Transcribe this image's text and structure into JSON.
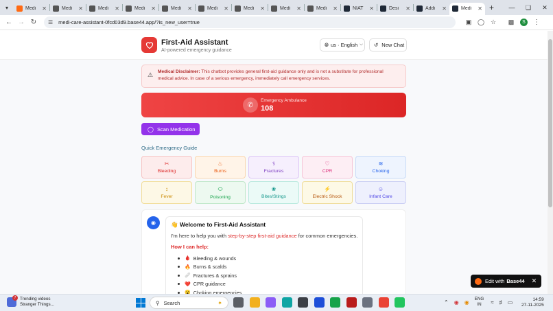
{
  "browser": {
    "tabs": [
      {
        "label": "Medi",
        "favicon_color": "#ff6a13",
        "active": false
      },
      {
        "label": "Medi",
        "favicon_color": "#555555",
        "active": false
      },
      {
        "label": "Medi",
        "favicon_color": "#555555",
        "active": false
      },
      {
        "label": "Medi",
        "favicon_color": "#555555",
        "active": false
      },
      {
        "label": "Medi",
        "favicon_color": "#555555",
        "active": false
      },
      {
        "label": "Medi",
        "favicon_color": "#555555",
        "active": false
      },
      {
        "label": "Medi",
        "favicon_color": "#555555",
        "active": false
      },
      {
        "label": "Medi",
        "favicon_color": "#555555",
        "active": false
      },
      {
        "label": "Medi",
        "favicon_color": "#555555",
        "active": false
      },
      {
        "label": "NIAT",
        "favicon_color": "#1f2937",
        "active": false
      },
      {
        "label": "Desi",
        "favicon_color": "#1f2937",
        "active": false
      },
      {
        "label": "Addi",
        "favicon_color": "#1f2937",
        "active": false
      },
      {
        "label": "Medi",
        "favicon_color": "#1f2937",
        "active": true
      }
    ],
    "url": "medi-care-assistant-0fcd03d9.base44.app/?is_new_user=true",
    "profile_initial": "S"
  },
  "app": {
    "title": "First-Aid Assistant",
    "subtitle": "AI-powered emergency guidance",
    "language": "us · English",
    "new_chat": "New Chat",
    "brand_color": "#e53935"
  },
  "disclaimer": {
    "heading": "Medical Disclaimer:",
    "text": " This chatbot provides general first-aid guidance only and is not a substitute for professional medical advice. In case of a serious emergency, immediately call emergency services."
  },
  "emergency": {
    "label": "Emergency Ambulance",
    "number": "108"
  },
  "scan_button": "Scan Medication",
  "guide": {
    "title": "Quick Emergency Guide",
    "items": [
      {
        "label": "Bleeding",
        "icon": "bleeding-icon",
        "glyph": "✂",
        "bg": "#fdecec",
        "border": "#f6c5c5",
        "color": "#dc2626"
      },
      {
        "label": "Burns",
        "icon": "flame-icon",
        "glyph": "♨",
        "bg": "#fff4e8",
        "border": "#fad7b0",
        "color": "#ea580c"
      },
      {
        "label": "Fractures",
        "icon": "bone-icon",
        "glyph": "⚕",
        "bg": "#f6effd",
        "border": "#ddc7f6",
        "color": "#7e3fc2"
      },
      {
        "label": "CPR",
        "icon": "heart-icon",
        "glyph": "♡",
        "bg": "#fdeef4",
        "border": "#f5c6d8",
        "color": "#db2777"
      },
      {
        "label": "Choking",
        "icon": "wind-icon",
        "glyph": "≋",
        "bg": "#eef4fe",
        "border": "#c8daf7",
        "color": "#2563eb"
      },
      {
        "label": "Fever",
        "icon": "thermometer-icon",
        "glyph": "↕",
        "bg": "#fdf8e6",
        "border": "#f1dd9a",
        "color": "#ca8a04"
      },
      {
        "label": "Poisoning",
        "icon": "pill-icon",
        "glyph": "⬭",
        "bg": "#edf9f0",
        "border": "#bfe7c9",
        "color": "#16a34a"
      },
      {
        "label": "Bites/Stings",
        "icon": "bug-icon",
        "glyph": "❀",
        "bg": "#ebfaf7",
        "border": "#b7e8dd",
        "color": "#0d9488"
      },
      {
        "label": "Electric Shock",
        "icon": "bolt-icon",
        "glyph": "⚡",
        "bg": "#fdf9e6",
        "border": "#efdc98",
        "color": "#b45309"
      },
      {
        "label": "Infant Care",
        "icon": "baby-icon",
        "glyph": "☺",
        "bg": "#eef0fd",
        "border": "#c9cdf3",
        "color": "#4f46e5"
      }
    ]
  },
  "chat": {
    "welcome_emoji": "👋",
    "welcome": "Welcome to First-Aid Assistant",
    "intro_pre": "I'm here to help you with ",
    "intro_highlight": "step-by-step first-aid guidance",
    "intro_post": " for common emergencies.",
    "how_title": "How I can help:",
    "help_items": [
      {
        "emoji": "🩸",
        "text": "Bleeding & wounds"
      },
      {
        "emoji": "🔥",
        "text": "Burns & scalds"
      },
      {
        "emoji": "🩹",
        "text": "Fractures & sprains"
      },
      {
        "emoji": "❤️",
        "text": "CPR guidance"
      },
      {
        "emoji": "😮",
        "text": "Choking emergencies"
      }
    ]
  },
  "badge": {
    "prefix": "Edit with",
    "brand": "Base44"
  },
  "taskbar": {
    "news_title": "Trending videos",
    "news_sub": "Stranger Things...",
    "news_count": "7",
    "search_placeholder": "Search",
    "lang_top": "ENG",
    "lang_bottom": "IN",
    "time": "14:59",
    "date": "27-11-2025"
  }
}
